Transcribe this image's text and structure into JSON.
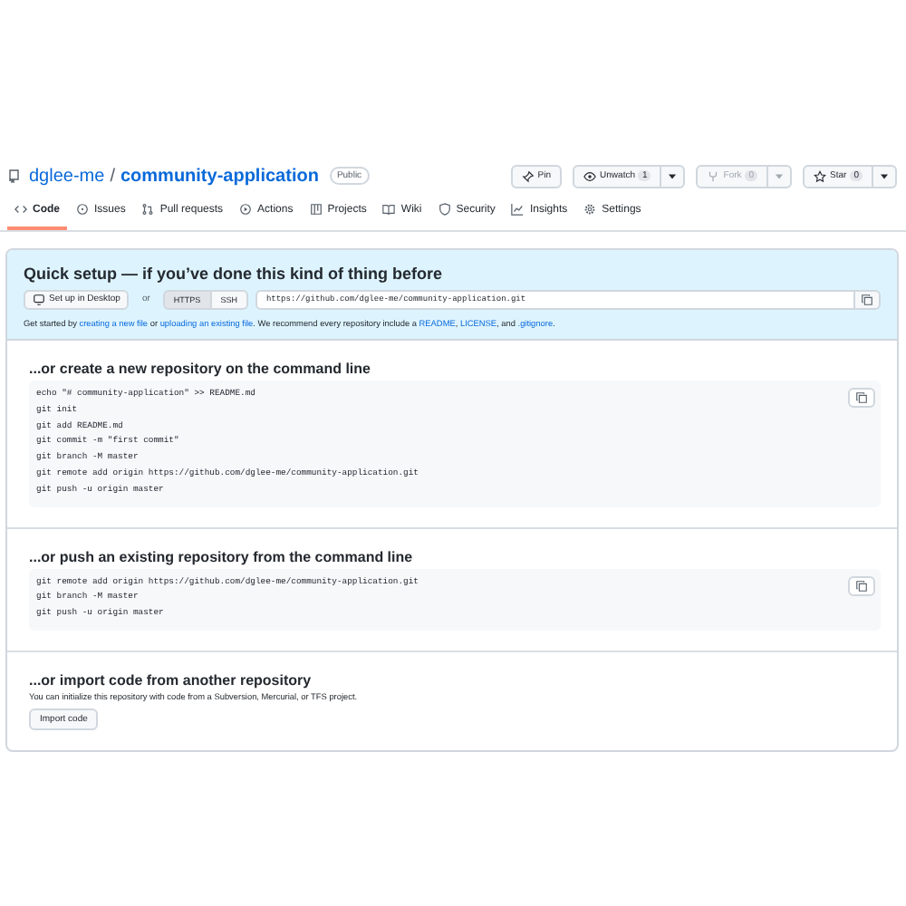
{
  "repo": {
    "owner": "dglee-me",
    "separator": "/",
    "name": "community-application",
    "visibility": "Public"
  },
  "actions": [
    {
      "kind": "pin",
      "label": "Pin",
      "disabled": false
    },
    {
      "kind": "watch",
      "label": "Unwatch",
      "count": "1",
      "disabled": false
    },
    {
      "kind": "fork",
      "label": "Fork",
      "count": "0",
      "disabled": true
    },
    {
      "kind": "star",
      "label": "Star",
      "count": "0",
      "disabled": false
    }
  ],
  "tabs": [
    {
      "kind": "code",
      "label": "Code",
      "selected": true
    },
    {
      "kind": "issues",
      "label": "Issues",
      "selected": false
    },
    {
      "kind": "pulls",
      "label": "Pull requests",
      "selected": false
    },
    {
      "kind": "actions",
      "label": "Actions",
      "selected": false
    },
    {
      "kind": "projects",
      "label": "Projects",
      "selected": false
    },
    {
      "kind": "wiki",
      "label": "Wiki",
      "selected": false
    },
    {
      "kind": "security",
      "label": "Security",
      "selected": false
    },
    {
      "kind": "insights",
      "label": "Insights",
      "selected": false
    },
    {
      "kind": "settings",
      "label": "Settings",
      "selected": false
    }
  ],
  "quick_setup": {
    "title": "Quick setup — if you’ve done this kind of thing before",
    "desktop_button": "Set up in Desktop",
    "or": "or",
    "protocols": [
      {
        "label": "HTTPS",
        "selected": true
      },
      {
        "label": "SSH",
        "selected": false
      }
    ],
    "url": "https://github.com/dglee-me/community-application.git",
    "hint": [
      {
        "kind": "text",
        "text": "Get started by "
      },
      {
        "kind": "link",
        "text": "creating a new file"
      },
      {
        "kind": "text",
        "text": " or "
      },
      {
        "kind": "link",
        "text": "uploading an existing file"
      },
      {
        "kind": "text",
        "text": ". We recommend every repository include a "
      },
      {
        "kind": "link",
        "text": "README"
      },
      {
        "kind": "text",
        "text": ", "
      },
      {
        "kind": "link",
        "text": "LICENSE"
      },
      {
        "kind": "text",
        "text": ", and "
      },
      {
        "kind": "link",
        "text": ".gitignore"
      },
      {
        "kind": "text",
        "text": "."
      }
    ]
  },
  "sections": [
    {
      "kind": "code",
      "title": "...or create a new repository on the command line",
      "lines": [
        "echo \"# community-application\" >> README.md",
        "git init",
        "git add README.md",
        "git commit -m \"first commit\"",
        "git branch -M master",
        "git remote add origin https://github.com/dglee-me/community-application.git",
        "git push -u origin master"
      ]
    },
    {
      "kind": "code",
      "title": "...or push an existing repository from the command line",
      "lines": [
        "git remote add origin https://github.com/dglee-me/community-application.git",
        "git branch -M master",
        "git push -u origin master"
      ]
    },
    {
      "kind": "import",
      "title": "...or import code from another repository",
      "description": "You can initialize this repository with code from a Subversion, Mercurial, or TFS project.",
      "button": "Import code"
    }
  ]
}
